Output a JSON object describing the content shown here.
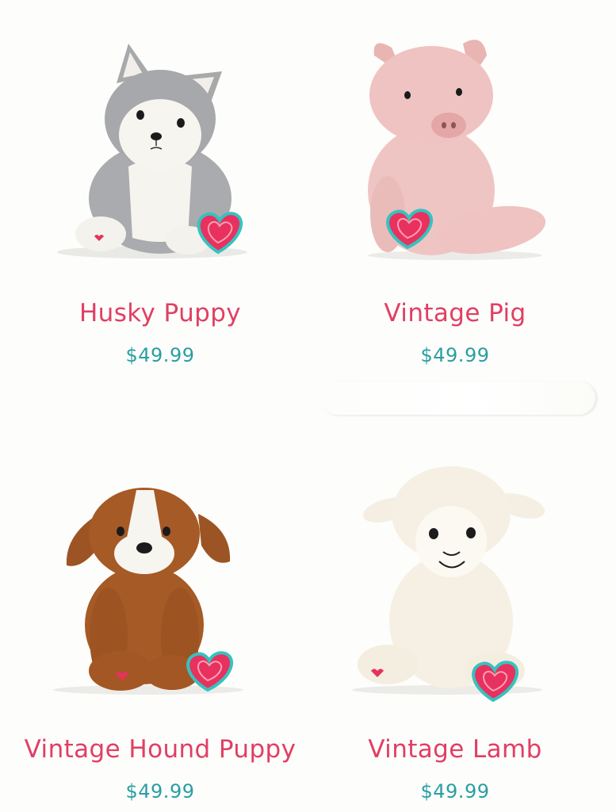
{
  "products": [
    {
      "name": "Husky Puppy",
      "price": "$49.99",
      "image_icon": "husky-plush-image"
    },
    {
      "name": "Vintage Pig",
      "price": "$49.99",
      "image_icon": "pig-plush-image"
    },
    {
      "name": "Vintage Hound Puppy",
      "price": "$49.99",
      "image_icon": "hound-plush-image"
    },
    {
      "name": "Vintage Lamb",
      "price": "$49.99",
      "image_icon": "lamb-plush-image"
    }
  ],
  "colors": {
    "name": "#e13e63",
    "price": "#2a9ea3",
    "heart": "#e8315e",
    "heart_outline": "#36c2bf",
    "background": "#fdfdfb"
  }
}
